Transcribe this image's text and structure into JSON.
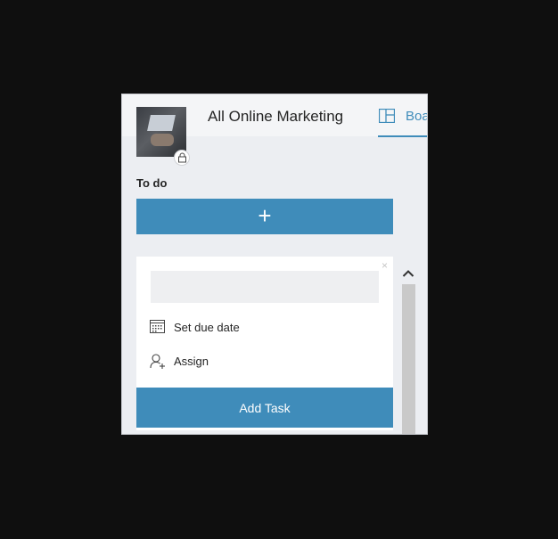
{
  "header": {
    "group_title": "All Online Marketing",
    "board_tab_label": "Boa"
  },
  "column": {
    "label": "To do",
    "add_button_label": "+"
  },
  "new_task_card": {
    "close_glyph": "×",
    "title_input_value": "",
    "title_input_placeholder": "",
    "due_date_label": "Set due date",
    "assign_label": "Assign",
    "add_task_label": "Add Task"
  },
  "icons": {
    "thumbnail": "group-photo",
    "lock": "lock-icon",
    "board": "board-icon",
    "calendar": "calendar-icon",
    "assign": "person-add-icon",
    "scroll_up": "chevron-up-icon"
  },
  "colors": {
    "accent": "#3f8cba",
    "background": "#0f0f0f",
    "panel": "#eceef2",
    "card": "#ffffff"
  }
}
